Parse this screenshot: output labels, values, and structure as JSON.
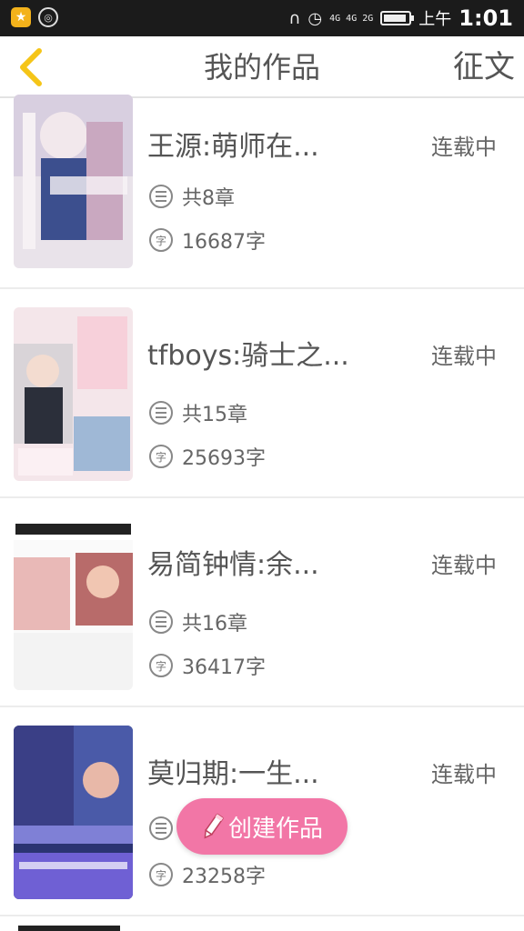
{
  "status_bar": {
    "network": "4G 4G 2G",
    "ampm": "上午",
    "time": "1:01"
  },
  "header": {
    "title": "我的作品",
    "action": "征文"
  },
  "works": [
    {
      "title": "王源:萌师在...",
      "status": "连载中",
      "chapters": "共8章",
      "words": "16687字",
      "cover_colors": [
        "#e7dfe6",
        "#3a4d8a"
      ]
    },
    {
      "title": "tfboys:骑士之...",
      "status": "连载中",
      "chapters": "共15章",
      "words": "25693字",
      "cover_colors": [
        "#f3d8e0",
        "#5a6f8c"
      ]
    },
    {
      "title": "易简钟情:余...",
      "status": "连载中",
      "chapters": "共16章",
      "words": "36417字",
      "cover_colors": [
        "#f5f5f5",
        "#e8a0a8"
      ]
    },
    {
      "title": "莫归期:一生...",
      "status": "连载中",
      "chapters": "",
      "words": "23258字",
      "cover_colors": [
        "#2a3570",
        "#6a5bd6"
      ]
    }
  ],
  "fab": {
    "label": "创建作品"
  },
  "icons": [
    "back-icon",
    "chapter-list-icon",
    "word-count-icon",
    "pencil-icon",
    "headphones-icon",
    "alarm-icon",
    "battery-icon"
  ],
  "colors": {
    "accent": "#f5c518",
    "fab": "#f276a6",
    "text": "#555555"
  }
}
